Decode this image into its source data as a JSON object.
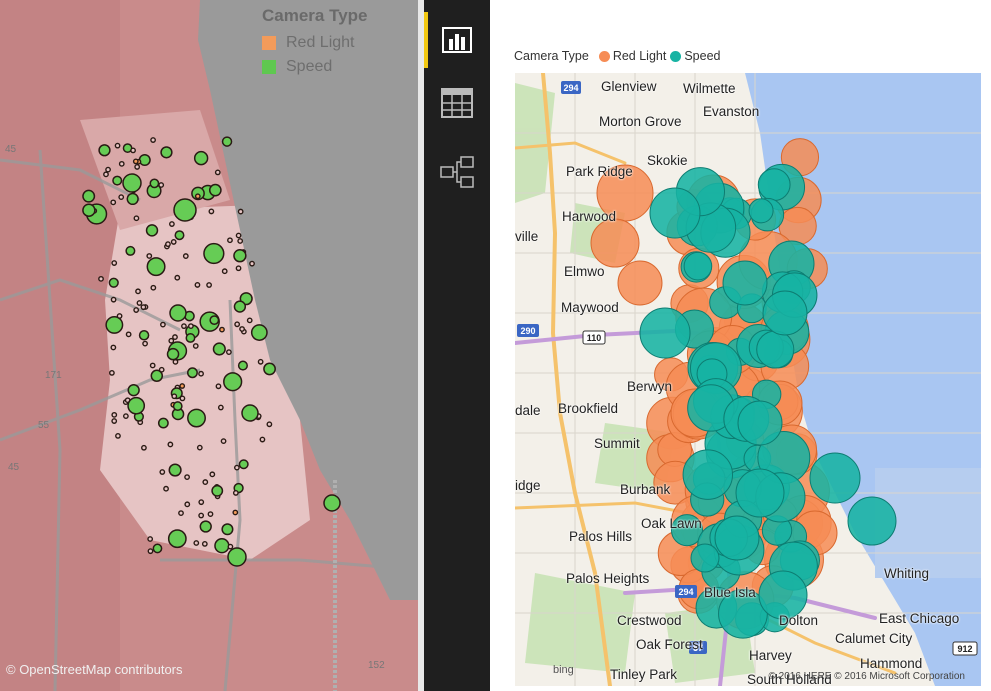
{
  "left_map": {
    "legend": {
      "title": "Camera Type",
      "items": [
        {
          "label": "Red Light",
          "color": "#f39b5a"
        },
        {
          "label": "Speed",
          "color": "#5fc850"
        }
      ]
    },
    "attribution": "© OpenStreetMap contributors",
    "colors": {
      "lake": "#9a9a9a",
      "land": "#c88a8a",
      "light_land": "#e8c7c7",
      "speed": "#66cc55",
      "red_light": "#f39b5a"
    },
    "highway_shields": [
      "45",
      "171",
      "55",
      "45",
      "152"
    ]
  },
  "toolbar": {
    "items": [
      {
        "name": "report-view",
        "icon": "bar-chart-icon",
        "active": true
      },
      {
        "name": "data-view",
        "icon": "table-icon",
        "active": false
      },
      {
        "name": "relationships-view",
        "icon": "relationships-icon",
        "active": false
      }
    ],
    "accent": "#f2c811"
  },
  "right_map": {
    "legend": {
      "title": "Camera Type",
      "items": [
        {
          "label": "Red Light",
          "color": "#f68c55"
        },
        {
          "label": "Speed",
          "color": "#17b3a3"
        }
      ]
    },
    "places": [
      "Glenview",
      "Wilmette",
      "Evanston",
      "Morton Grove",
      "Skokie",
      "Park Ridge",
      "Harwood",
      "ville",
      "Elmwo",
      "Maywood",
      "Berwyn",
      "Brookfield",
      "Summit",
      "Burbank",
      "Oak Lawn",
      "Palos Hills",
      "Palos Heights",
      "Blue Isla",
      "Crestwood",
      "Oak Forest",
      "Tinley Park",
      "Whiting",
      "East Chicago",
      "Calumet City",
      "Dolton",
      "Harvey",
      "South Holland",
      "Hammond",
      "idge",
      "dale"
    ],
    "road_shields": [
      "294",
      "290",
      "110",
      "294",
      "57",
      "912"
    ],
    "attribution": "© 2016 HERE   © 2016 Microsoft Corporation",
    "provider": "bing",
    "colors": {
      "water": "#a9c6f2",
      "land": "#f4f1ea"
    }
  }
}
